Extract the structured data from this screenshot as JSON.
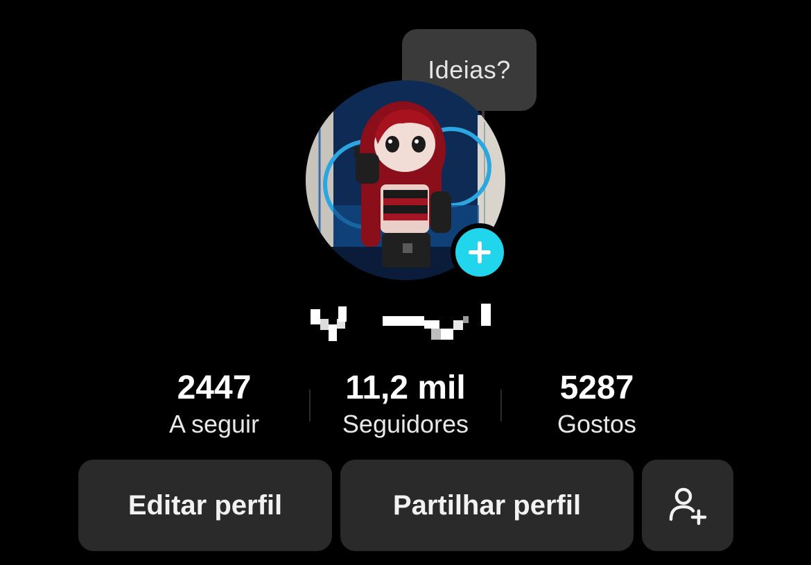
{
  "tooltip": {
    "text": "Ideias?"
  },
  "avatar": {
    "description_icon": "profile-avatar",
    "add_icon": "plus-icon",
    "accent": "#20d5ec"
  },
  "stats": {
    "following": {
      "value": "2447",
      "label": "A seguir"
    },
    "followers": {
      "value": "11,2 mil",
      "label": "Seguidores"
    },
    "likes": {
      "value": "5287",
      "label": "Gostos"
    }
  },
  "actions": {
    "edit_label": "Editar perfil",
    "share_label": "Partilhar perfil",
    "add_friend_icon": "add-friend-icon"
  },
  "colors": {
    "background": "#000000",
    "button_bg": "#2a2a2a",
    "tooltip_bg": "#3a3a3a",
    "accent": "#20d5ec"
  }
}
